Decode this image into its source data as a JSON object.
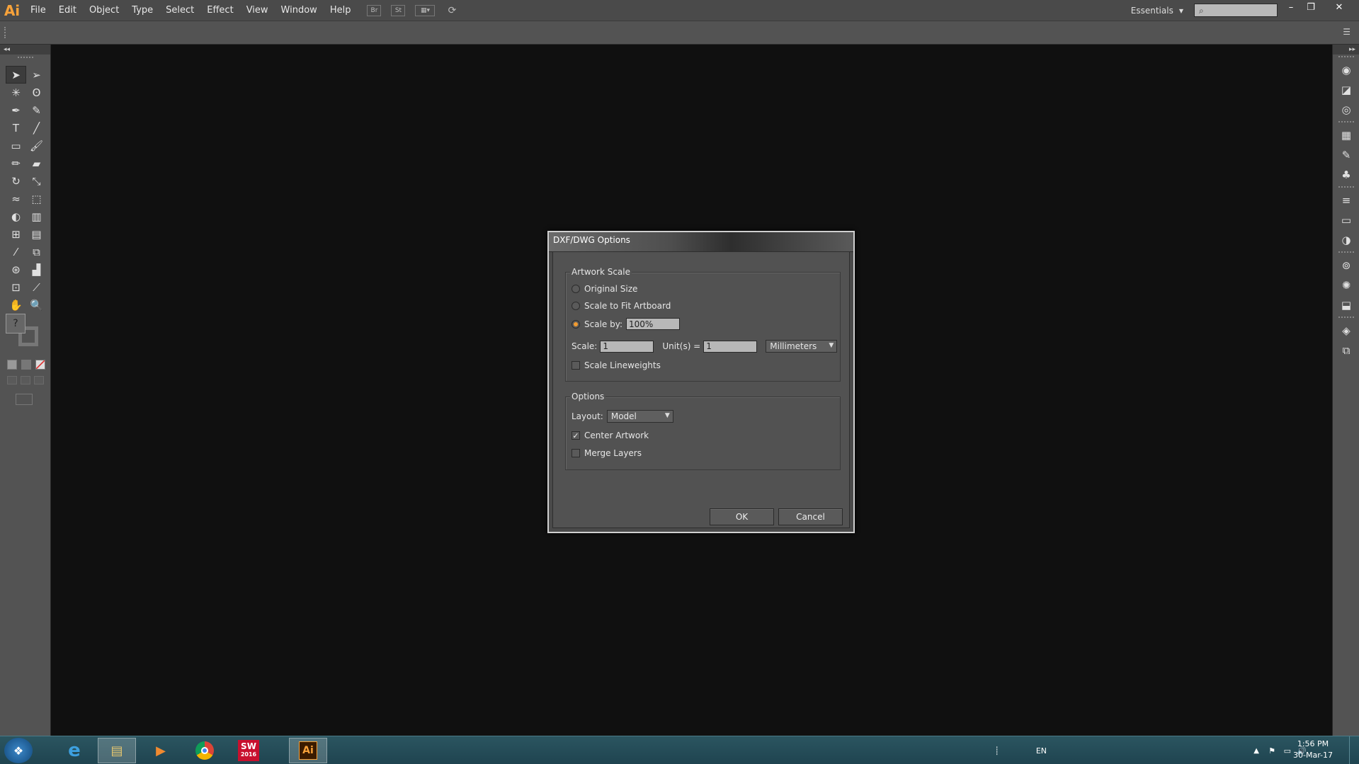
{
  "app": {
    "logo": "Ai",
    "menus": [
      "File",
      "Edit",
      "Object",
      "Type",
      "Select",
      "Effect",
      "View",
      "Window",
      "Help"
    ],
    "bridge_label": "Br",
    "stock_label": "St",
    "workspace": "Essentials",
    "search_placeholder": ""
  },
  "window_controls": {
    "minimize": "–",
    "restore": "❐",
    "close": "✕"
  },
  "tools": {
    "panel_collapse": "◂◂",
    "fill_stroke_label": "?"
  },
  "dock": {
    "panel_collapse": "▸▸"
  },
  "dialog": {
    "title": "DXF/DWG Options",
    "artwork_scale": {
      "legend": "Artwork Scale",
      "original_size": "Original Size",
      "scale_to_fit": "Scale to Fit Artboard",
      "scale_by": "Scale by:",
      "scale_by_value": "100%",
      "scale_label": "Scale:",
      "scale_value": "1",
      "units_label": "Unit(s) =",
      "units_value": "1",
      "unit_select": "Millimeters",
      "scale_lineweights": "Scale Lineweights",
      "selected": "scale_by",
      "scale_lineweights_checked": false
    },
    "options": {
      "legend": "Options",
      "layout_label": "Layout:",
      "layout_value": "Model",
      "center_artwork": "Center Artwork",
      "center_artwork_checked": true,
      "merge_layers": "Merge Layers",
      "merge_layers_checked": false
    },
    "ok": "OK",
    "cancel": "Cancel"
  },
  "taskbar": {
    "apps": [
      "internet-explorer",
      "file-explorer",
      "media-player",
      "chrome",
      "solidworks",
      "illustrator"
    ],
    "solidworks_label": "SW",
    "solidworks_year": "2016",
    "illustrator_label": "Ai",
    "language": "EN",
    "time": "1:56 PM",
    "date": "30-Mar-17"
  },
  "colors": {
    "accent": "#f29b30",
    "ai_orange": "#f7a23a",
    "taskbar": "#2b5560"
  }
}
